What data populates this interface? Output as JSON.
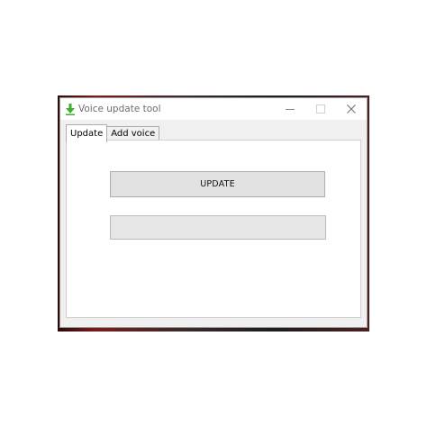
{
  "window": {
    "title": "Voice update tool",
    "icon": "download-arrow-icon",
    "controls": [
      "minimize-icon",
      "maximize-icon",
      "close-icon"
    ]
  },
  "tabs": [
    {
      "label": "Update",
      "active": true
    },
    {
      "label": "Add voice",
      "active": false
    }
  ],
  "update_tab": {
    "update_button_label": "UPDATE",
    "progress": 0
  },
  "colors": {
    "icon_green": "#3fae2a",
    "button_bg": "#e1e1e1",
    "progress_fill": "#06b025"
  }
}
